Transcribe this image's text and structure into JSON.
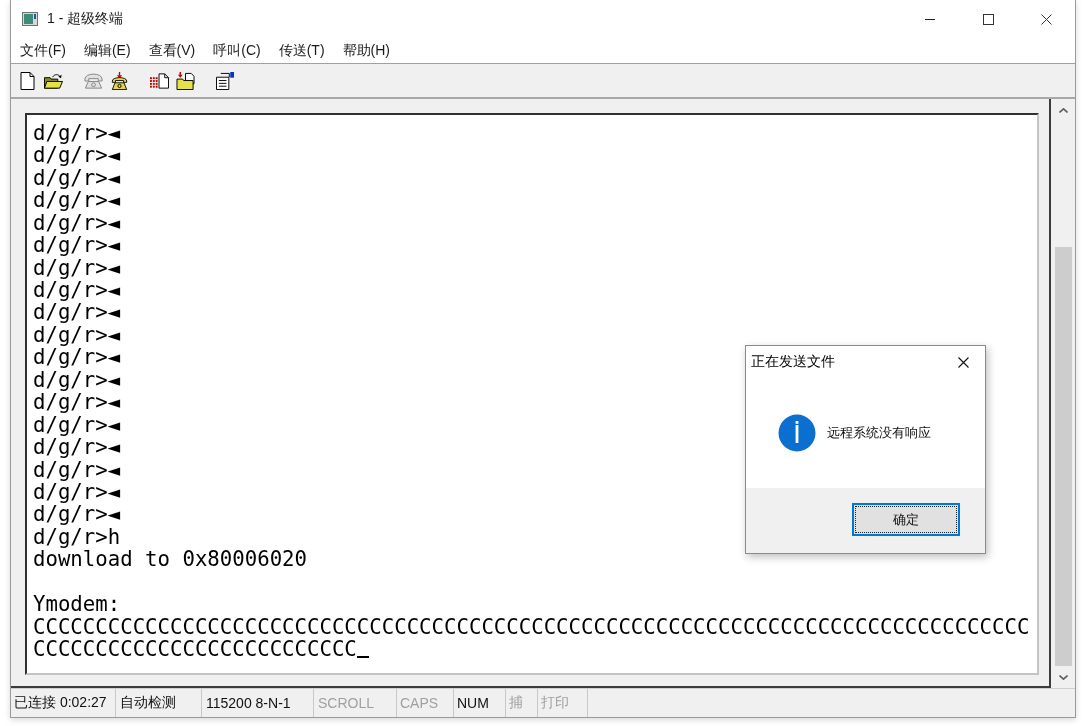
{
  "window": {
    "title": "1 - 超级终端"
  },
  "menu": [
    "文件(F)",
    "编辑(E)",
    "查看(V)",
    "呼叫(C)",
    "传送(T)",
    "帮助(H)"
  ],
  "toolbar": [
    [
      {
        "kind": "new",
        "disabled": false
      },
      {
        "kind": "open",
        "disabled": false
      }
    ],
    [
      {
        "kind": "call",
        "disabled": true
      },
      {
        "kind": "hangup",
        "disabled": false
      }
    ],
    [
      {
        "kind": "send",
        "disabled": false
      },
      {
        "kind": "receive",
        "disabled": false
      }
    ],
    [
      {
        "kind": "properties",
        "disabled": false
      }
    ]
  ],
  "terminal": {
    "blocks": [
      {
        "lines": [
          "d/g/r>◄",
          "d/g/r>◄",
          "d/g/r>◄",
          "d/g/r>◄",
          "d/g/r>◄",
          "d/g/r>◄",
          "d/g/r>◄",
          "d/g/r>◄",
          "d/g/r>◄",
          "d/g/r>◄",
          "d/g/r>◄",
          "d/g/r>◄",
          "d/g/r>◄",
          "d/g/r>◄",
          "d/g/r>◄",
          "d/g/r>◄",
          "d/g/r>◄",
          "d/g/r>◄",
          "d/g/r>h",
          "download to 0x80006020"
        ]
      },
      {
        "lines": [
          "Ymodem:",
          "CCCCCCCCCCCCCCCCCCCCCCCCCCCCCCCCCCCCCCCCCCCCCCCCCCCCCCCCCCCCCCCCCCCCCCCCCCCCCCCC",
          "CCCCCCCCCCCCCCCCCCCCCCCCCC"
        ]
      }
    ],
    "cursor": true
  },
  "status_bar": [
    {
      "text": "已连接 0:02:27",
      "dimmed": false
    },
    {
      "text": "自动检测",
      "dimmed": false
    },
    {
      "text": "115200 8-N-1",
      "dimmed": false
    },
    {
      "text": "SCROLL",
      "dimmed": true
    },
    {
      "text": "CAPS",
      "dimmed": true
    },
    {
      "text": "NUM",
      "dimmed": false
    },
    {
      "text": "捕",
      "dimmed": true
    },
    {
      "text": "打印",
      "dimmed": true
    }
  ],
  "dialog": {
    "title": "正在发送文件",
    "message": "远程系统没有响应",
    "button": {
      "label": "确定",
      "focused": true
    }
  }
}
